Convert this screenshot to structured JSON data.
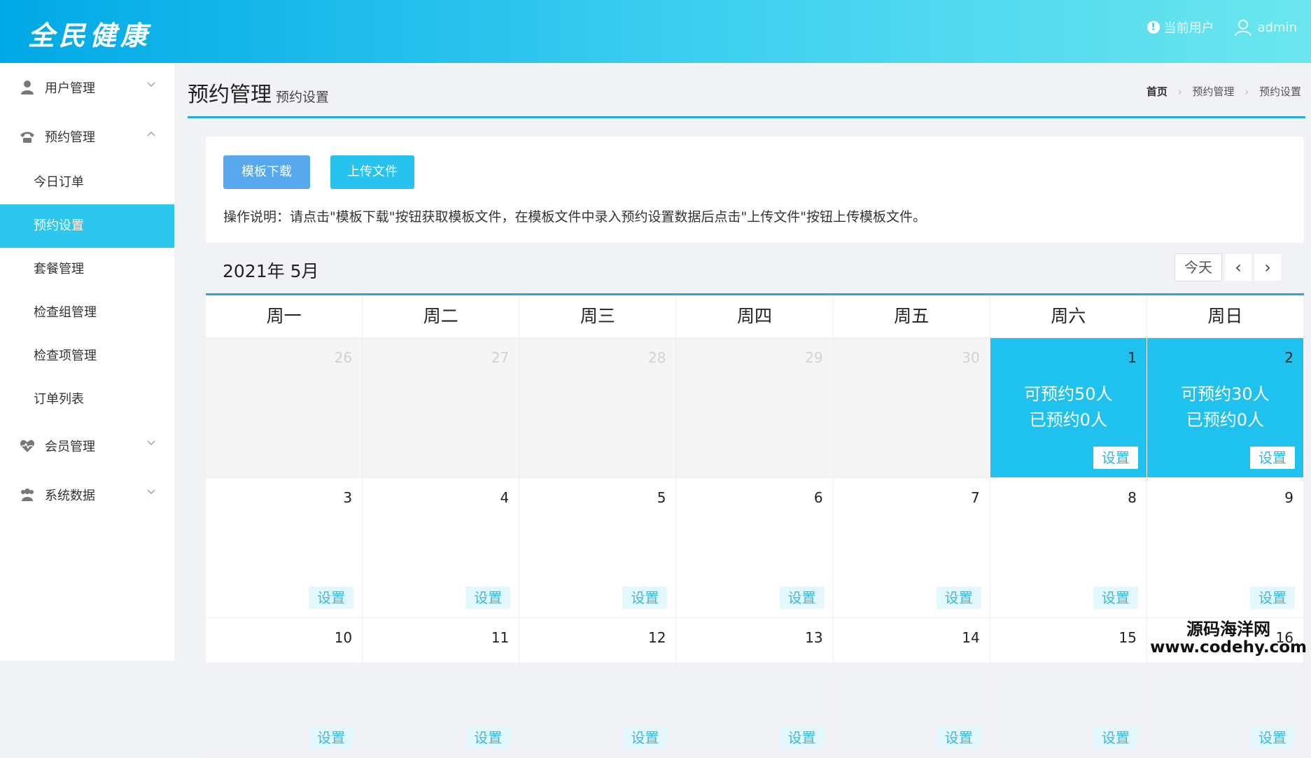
{
  "header": {
    "logo": "全民健康",
    "current_user_label": "当前用户",
    "username": "admin"
  },
  "sidebar": {
    "groups": [
      {
        "label": "用户管理",
        "icon": "user-icon"
      },
      {
        "label": "预约管理",
        "icon": "phone-icon"
      },
      {
        "label": "会员管理",
        "icon": "heartbeat-icon"
      },
      {
        "label": "系统数据",
        "icon": "users-icon"
      }
    ],
    "sub_items": [
      "今日订单",
      "预约设置",
      "套餐管理",
      "检查组管理",
      "检查项管理",
      "订单列表"
    ],
    "active_item": "预约设置"
  },
  "page": {
    "title": "预约管理",
    "subtitle": "预约设置",
    "breadcrumb": [
      "首页",
      "预约管理",
      "预约设置"
    ]
  },
  "actions": {
    "download_label": "模板下载",
    "upload_label": "上传文件",
    "instruction": "操作说明：请点击\"模板下载\"按钮获取模板文件，在模板文件中录入预约设置数据后点击\"上传文件\"按钮上传模板文件。"
  },
  "calendar": {
    "month_title": "2021年 5月",
    "today_label": "今天",
    "prev_label": "‹",
    "next_label": "›",
    "weekdays": [
      "周一",
      "周二",
      "周三",
      "周四",
      "周五",
      "周六",
      "周日"
    ],
    "set_label": "设置",
    "rows": [
      [
        {
          "day": "26",
          "other": true
        },
        {
          "day": "27",
          "other": true
        },
        {
          "day": "28",
          "other": true
        },
        {
          "day": "29",
          "other": true
        },
        {
          "day": "30",
          "other": true
        },
        {
          "day": "1",
          "available": "可预约50人",
          "booked": "已预约0人"
        },
        {
          "day": "2",
          "available": "可预约30人",
          "booked": "已预约0人"
        }
      ],
      [
        {
          "day": "3"
        },
        {
          "day": "4"
        },
        {
          "day": "5"
        },
        {
          "day": "6"
        },
        {
          "day": "7"
        },
        {
          "day": "8"
        },
        {
          "day": "9"
        }
      ],
      [
        {
          "day": "10"
        },
        {
          "day": "11"
        },
        {
          "day": "12"
        },
        {
          "day": "13"
        },
        {
          "day": "14"
        },
        {
          "day": "15"
        },
        {
          "day": "16"
        }
      ]
    ]
  },
  "watermark": {
    "line1": "源码海洋网",
    "line2": "www.codehy.com"
  },
  "colors": {
    "accent": "#2cc6ee",
    "available_cell": "#1fc2ef",
    "download_button": "#58a8ee"
  }
}
